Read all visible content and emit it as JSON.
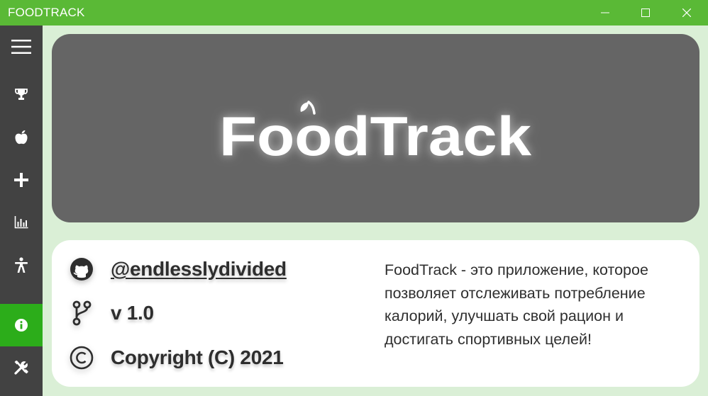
{
  "window": {
    "title": "FOODTRACK",
    "controls": [
      "minimize-icon",
      "maximize-icon",
      "close-icon"
    ]
  },
  "sidebar": {
    "items": [
      {
        "icon": "hamburger-menu-icon",
        "active": false
      },
      {
        "icon": "trophy-icon",
        "active": false
      },
      {
        "icon": "apple-icon",
        "active": false
      },
      {
        "icon": "plus-icon",
        "active": false
      },
      {
        "icon": "bar-chart-icon",
        "active": false
      },
      {
        "icon": "accessibility-icon",
        "active": false
      },
      {
        "icon": "info-icon",
        "active": true
      },
      {
        "icon": "tools-icon",
        "active": false
      }
    ],
    "active_color": "#2cad1a",
    "background": "#424242"
  },
  "banner": {
    "logo_text": "FoodTrack",
    "background": "#656565"
  },
  "info": {
    "github_handle": "@endlesslydivided",
    "version": "v 1.0",
    "copyright": "Copyright (C) 2021",
    "description": "FoodTrack - это приложение, которое позволяет отслеживать потребление калорий, улучшать свой рацион  и достигать спортивных целей!"
  },
  "colors": {
    "titlebar": "#5ab936",
    "page_background": "#daefd6"
  }
}
